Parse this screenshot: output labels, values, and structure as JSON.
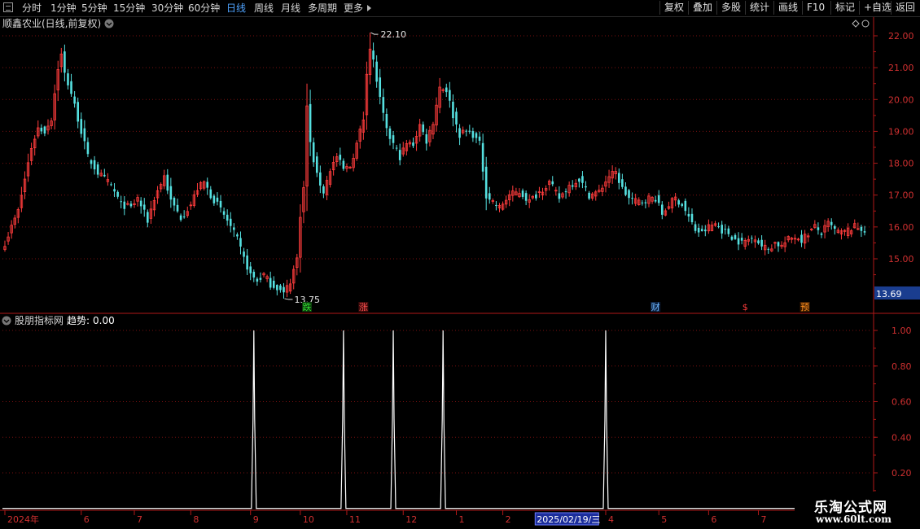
{
  "toolbar": {
    "periods": [
      "分时",
      "1分钟",
      "5分钟",
      "15分钟",
      "30分钟",
      "60分钟",
      "日线",
      "周线",
      "月线",
      "多周期",
      "更多"
    ],
    "active_period": "日线",
    "buttons": [
      "复权",
      "叠加",
      "多股",
      "统计",
      "画线",
      "F10",
      "标记",
      "+自选",
      "返回"
    ]
  },
  "colors": {
    "up": "#ff3c3c",
    "down": "#55e0e0",
    "grid": "#7a1010",
    "axis": "#b01818",
    "tick_text": "#d03030",
    "last_price_bg": "#1a3d8f",
    "date_highlight_bg": "#1c2e9c"
  },
  "chart_data": [
    {
      "type": "candlestick",
      "title": "顺鑫农业(日线,前复权)",
      "y_ticks": [
        15.0,
        16.0,
        17.0,
        18.0,
        19.0,
        20.0,
        21.0,
        22.0
      ],
      "ylim": [
        13.3,
        22.4
      ],
      "last_price": "13.69",
      "annotations": [
        {
          "label": "22.10",
          "index": 110,
          "value": 22.1,
          "kind": "high"
        },
        {
          "label": "13.75",
          "index": 84,
          "value": 13.75,
          "kind": "low"
        }
      ],
      "markers": [
        {
          "text": "跌",
          "index": 91,
          "color": "#33dd33",
          "bg": "#0b3d0b"
        },
        {
          "text": "涨",
          "index": 108,
          "color": "#ff5050",
          "bg": "#3d0b0b"
        },
        {
          "text": "财",
          "index": 196,
          "color": "#6fb8ff",
          "bg": "#0b1f3d"
        },
        {
          "text": "$",
          "index": 223,
          "color": "#ff3c3c",
          "bg": "#000000"
        },
        {
          "text": "预",
          "index": 241,
          "color": "#ff9020",
          "bg": "#3d1c00"
        }
      ],
      "n": 260,
      "anchors": [
        [
          0,
          15.5
        ],
        [
          4,
          16.5
        ],
        [
          6,
          17.5
        ],
        [
          8,
          18.5
        ],
        [
          10,
          19.1
        ],
        [
          12,
          19.0
        ],
        [
          14,
          19.4
        ],
        [
          16,
          21.0
        ],
        [
          17,
          21.4
        ],
        [
          18,
          20.8
        ],
        [
          20,
          20.2
        ],
        [
          22,
          19.4
        ],
        [
          25,
          18.2
        ],
        [
          28,
          17.7
        ],
        [
          32,
          17.3
        ],
        [
          35,
          16.7
        ],
        [
          38,
          16.6
        ],
        [
          40,
          16.9
        ],
        [
          43,
          16.2
        ],
        [
          45,
          16.9
        ],
        [
          48,
          17.6
        ],
        [
          50,
          16.8
        ],
        [
          53,
          16.3
        ],
        [
          56,
          16.7
        ],
        [
          58,
          17.2
        ],
        [
          60,
          17.4
        ],
        [
          62,
          17.0
        ],
        [
          64,
          16.7
        ],
        [
          67,
          16.2
        ],
        [
          70,
          15.6
        ],
        [
          72,
          15.0
        ],
        [
          74,
          14.5
        ],
        [
          76,
          14.3
        ],
        [
          78,
          14.5
        ],
        [
          80,
          14.2
        ],
        [
          82,
          14.1
        ],
        [
          84,
          13.9
        ],
        [
          86,
          14.3
        ],
        [
          88,
          15.0
        ],
        [
          89,
          16.4
        ],
        [
          90,
          17.2
        ],
        [
          91,
          19.8
        ],
        [
          92,
          18.6
        ],
        [
          94,
          17.6
        ],
        [
          96,
          17.1
        ],
        [
          98,
          17.8
        ],
        [
          100,
          18.2
        ],
        [
          102,
          17.8
        ],
        [
          104,
          17.9
        ],
        [
          106,
          18.6
        ],
        [
          108,
          19.4
        ],
        [
          109,
          20.9
        ],
        [
          110,
          21.6
        ],
        [
          111,
          21.2
        ],
        [
          113,
          20.0
        ],
        [
          115,
          19.0
        ],
        [
          117,
          18.6
        ],
        [
          119,
          18.2
        ],
        [
          121,
          18.6
        ],
        [
          123,
          18.6
        ],
        [
          125,
          19.2
        ],
        [
          127,
          18.7
        ],
        [
          129,
          19.3
        ],
        [
          131,
          20.4
        ],
        [
          133,
          20.3
        ],
        [
          135,
          19.5
        ],
        [
          137,
          18.9
        ],
        [
          139,
          19.0
        ],
        [
          141,
          18.9
        ],
        [
          143,
          18.6
        ],
        [
          145,
          17.0
        ],
        [
          147,
          16.8
        ],
        [
          149,
          16.6
        ],
        [
          152,
          17.0
        ],
        [
          155,
          17.1
        ],
        [
          158,
          16.8
        ],
        [
          161,
          17.1
        ],
        [
          164,
          17.4
        ],
        [
          167,
          16.9
        ],
        [
          170,
          17.3
        ],
        [
          173,
          17.5
        ],
        [
          176,
          17.0
        ],
        [
          179,
          17.1
        ],
        [
          182,
          17.6
        ],
        [
          184,
          17.7
        ],
        [
          186,
          17.2
        ],
        [
          188,
          16.9
        ],
        [
          190,
          16.8
        ],
        [
          192,
          16.8
        ],
        [
          194,
          16.9
        ],
        [
          196,
          16.9
        ],
        [
          198,
          16.4
        ],
        [
          200,
          16.7
        ],
        [
          202,
          16.9
        ],
        [
          204,
          16.7
        ],
        [
          206,
          16.3
        ],
        [
          208,
          15.9
        ],
        [
          210,
          15.8
        ],
        [
          212,
          16.0
        ],
        [
          214,
          16.1
        ],
        [
          216,
          15.9
        ],
        [
          218,
          15.8
        ],
        [
          220,
          15.6
        ],
        [
          222,
          15.5
        ],
        [
          224,
          15.6
        ],
        [
          226,
          15.7
        ],
        [
          228,
          15.4
        ],
        [
          230,
          15.3
        ],
        [
          232,
          15.5
        ],
        [
          234,
          15.4
        ],
        [
          236,
          15.6
        ],
        [
          238,
          15.7
        ],
        [
          240,
          15.6
        ],
        [
          242,
          15.8
        ],
        [
          244,
          16.0
        ],
        [
          246,
          15.8
        ],
        [
          248,
          16.1
        ],
        [
          250,
          15.9
        ],
        [
          252,
          15.8
        ],
        [
          254,
          15.9
        ],
        [
          256,
          16.0
        ],
        [
          259,
          15.9
        ]
      ]
    },
    {
      "type": "line",
      "title": "股朋指标网",
      "legend_label": "趋势:",
      "legend_value": "0.00",
      "y_ticks": [
        0.2,
        0.4,
        0.6,
        0.8,
        1.0
      ],
      "ylim": [
        -0.08,
        1.06
      ],
      "spikes_at_index": [
        75,
        102,
        117,
        132,
        181
      ],
      "x": {
        "labels": [
          {
            "text": "2024年",
            "index": 0
          },
          {
            "text": "6",
            "index": 23
          },
          {
            "text": "7",
            "index": 39
          },
          {
            "text": "8",
            "index": 56
          },
          {
            "text": "9",
            "index": 74
          },
          {
            "text": "10",
            "index": 89
          },
          {
            "text": "11",
            "index": 103
          },
          {
            "text": "12",
            "index": 120
          },
          {
            "text": "1",
            "index": 136
          },
          {
            "text": "2",
            "index": 150
          },
          {
            "text": "2025/02/19/三",
            "index": 159,
            "highlight": true
          },
          {
            "text": "4",
            "index": 181
          },
          {
            "text": "5",
            "index": 197
          },
          {
            "text": "6",
            "index": 212
          },
          {
            "text": "7",
            "index": 227
          }
        ]
      }
    }
  ],
  "watermark": {
    "title": "乐淘公式网",
    "url": "www.60lt.com"
  }
}
